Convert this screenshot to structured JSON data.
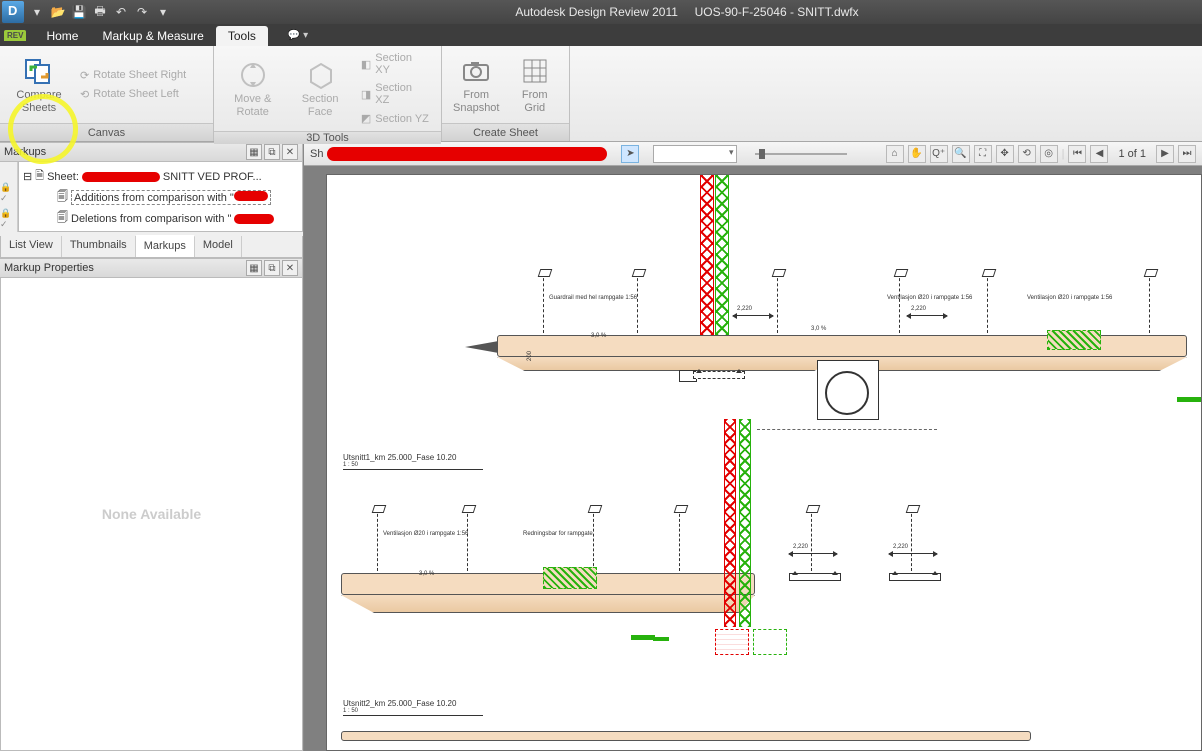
{
  "title": {
    "app": "Autodesk Design Review 2011",
    "file": "UOS-90-F-25046 - SNITT.dwfx"
  },
  "qat": {
    "open": "⎋",
    "save": "💾",
    "print": "🖶",
    "undo": "↶",
    "redo": "↷",
    "more": "▾"
  },
  "tabs": {
    "home": "Home",
    "markup": "Markup & Measure",
    "tools": "Tools"
  },
  "ribbon": {
    "canvas": {
      "label": "Canvas",
      "compare1": "Compare",
      "compare2": "Sheets",
      "rot_right": "Rotate Sheet Right",
      "rot_left": "Rotate Sheet Left"
    },
    "tools3d": {
      "label": "3D Tools",
      "move1": "Move &",
      "move2": "Rotate",
      "face1": "Section",
      "face2": "Face",
      "sxy": "Section XY",
      "sxz": "Section XZ",
      "syz": "Section YZ"
    },
    "createsheet": {
      "label": "Create Sheet",
      "snap1": "From",
      "snap2": "Snapshot",
      "grid1": "From",
      "grid2": "Grid"
    }
  },
  "left": {
    "markups_title": "Markups",
    "sheet_prefix": "Sheet: ",
    "sheet_suffix": "SNITT VED PROF...",
    "additions": "Additions from comparison with \"",
    "deletions": "Deletions from comparison with \"",
    "tabs": {
      "list": "List View",
      "thumb": "Thumbnails",
      "markups": "Markups",
      "model": "Model"
    },
    "props_title": "Markup Properties",
    "none": "None Available"
  },
  "toolbar": {
    "sheet_prefix": "Sh",
    "pager": "1 of 1"
  },
  "drawing": {
    "section1": "Utsnitt1_km 25.000_Fase 10.20",
    "section2": "Utsnitt2_km 25.000_Fase 10.20",
    "scale": "1 : 50",
    "dim_2220": "2,220",
    "pct_300": "3,0 %",
    "pct_30": "3,0 %",
    "note_guard": "Guardrail med hel rampgate 1:56",
    "note_vent": "Ventilasjon Ø20 i rampgate 1:56",
    "note_redline": "Redningsbar for rampgate",
    "clr_200": "200"
  }
}
